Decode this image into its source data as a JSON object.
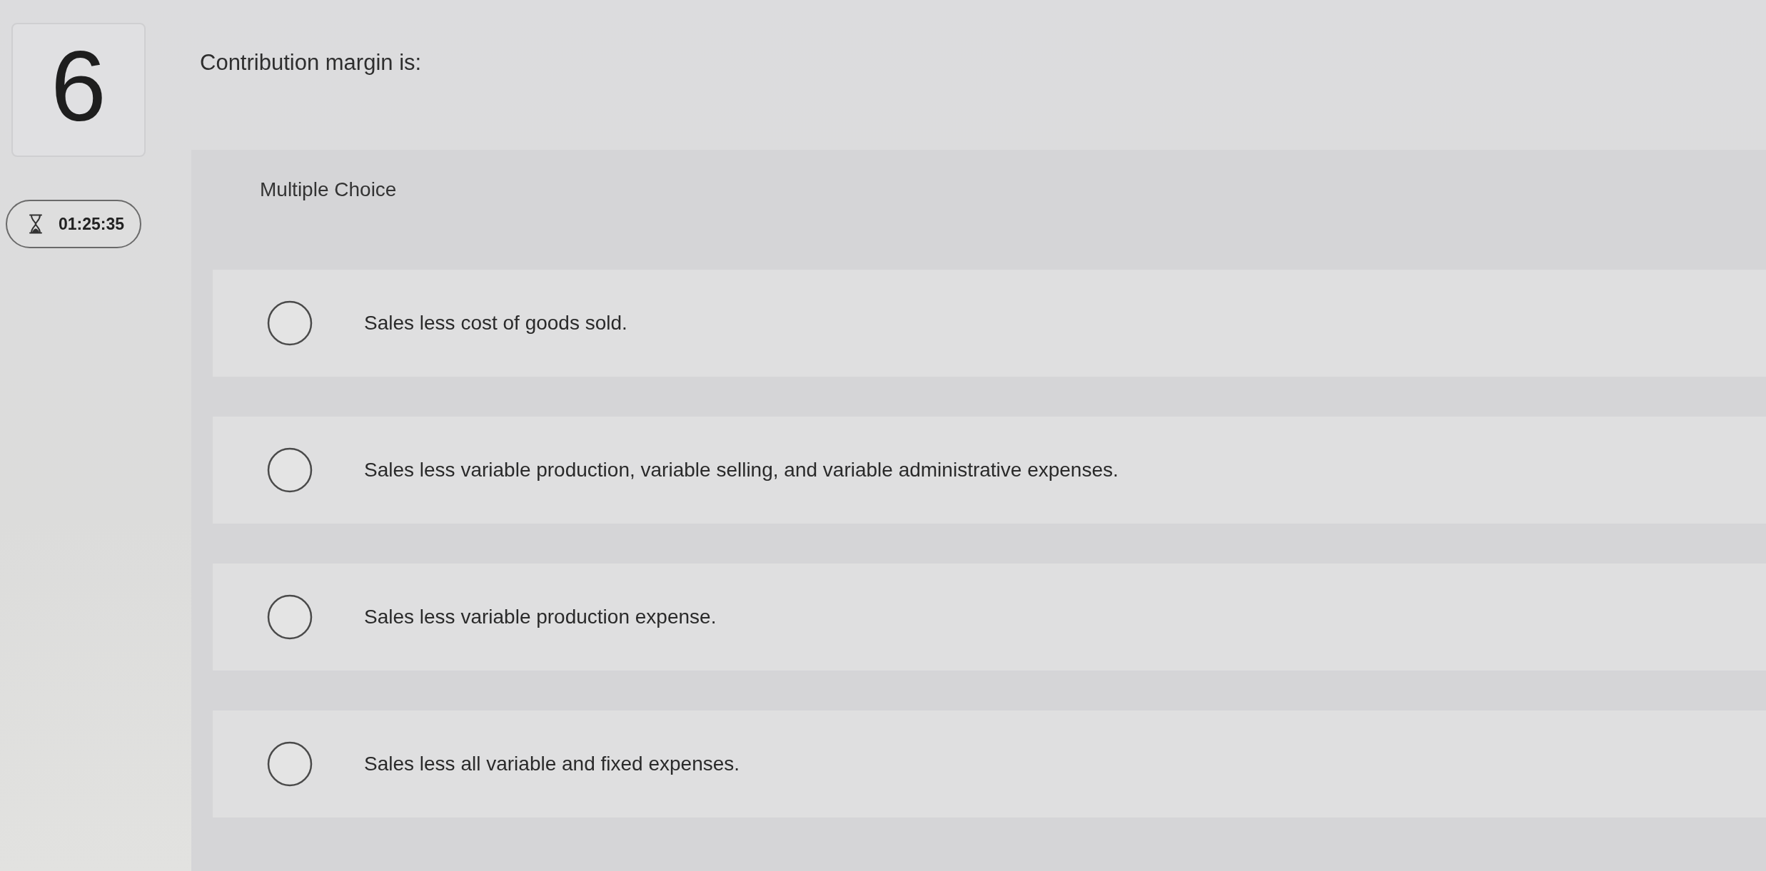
{
  "question": {
    "number": "6",
    "text": "Contribution margin is:"
  },
  "timer": {
    "time": "01:25:35"
  },
  "answer_panel": {
    "type_label": "Multiple Choice",
    "choices": [
      {
        "text": "Sales less cost of goods sold.",
        "selected": false
      },
      {
        "text": "Sales less variable production, variable selling, and variable administrative expenses.",
        "selected": false
      },
      {
        "text": "Sales less variable production expense.",
        "selected": false
      },
      {
        "text": "Sales less all variable and fixed expenses.",
        "selected": false
      }
    ]
  }
}
